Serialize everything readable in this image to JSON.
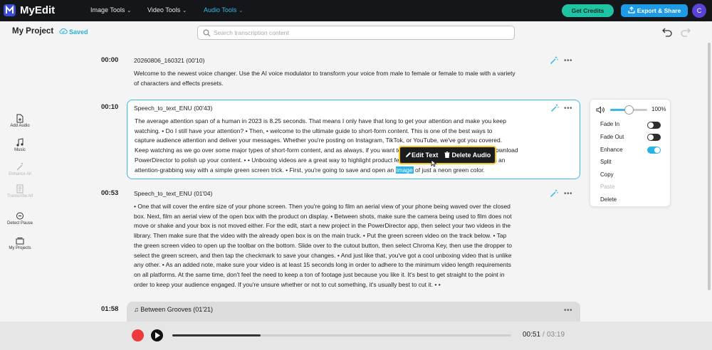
{
  "app": {
    "name": "MyEdit"
  },
  "nav": [
    {
      "label": "Image Tools",
      "active": false
    },
    {
      "label": "Video Tools",
      "active": false
    },
    {
      "label": "Audio Tools",
      "active": true
    }
  ],
  "header": {
    "get_credits": "Get Credits",
    "export_share": "Export & Share",
    "avatar_initial": "C"
  },
  "project": {
    "title": "My Project",
    "status": "Saved"
  },
  "search": {
    "placeholder": "Search transcription content",
    "value": ""
  },
  "sidebar": [
    {
      "label": "Add Audio",
      "icon": "add-audio-icon",
      "enabled": true
    },
    {
      "label": "Music",
      "icon": "music-icon",
      "enabled": true
    },
    {
      "label": "Enhance All",
      "icon": "enhance-icon",
      "enabled": false
    },
    {
      "label": "Transcribe All",
      "icon": "transcribe-icon",
      "enabled": false
    },
    {
      "label": "Detect Pause",
      "icon": "detect-pause-icon",
      "enabled": true
    },
    {
      "label": "My Projects",
      "icon": "folder-icon",
      "enabled": true
    }
  ],
  "transcript": [
    {
      "time": "00:00",
      "title": "20260806_160321  (00'10)",
      "lines": [
        "Welcome to the newest voice changer. Use the AI voice modulator to transform your voice from male to female or female to male with a variety",
        "of characters and effects presets."
      ]
    },
    {
      "time": "00:10",
      "title": "Speech_to_text_ENU  (00'43)",
      "lines": [
        "The average attention span of a human in 2023 is 8.25 seconds. That means I only have that long to get your attention and make you keep",
        "watching.  •  Do I still have your attention?  •  Then,  •  welcome to the ultimate guide to short-form content. This is one of the best ways to",
        "capture audience attention and deliver your messages. Whether you're posting on Instagram, TikTok, or YouTube, we've got you covered.",
        "Keep watching as we go over some major types of short-form content, and as always, if you want to follow along, click the button and download",
        "PowerDirector to polish up your content.  •  •  Unboxing videos are a great way to highlight product features, and you can execute them in an",
        "attention-grabbing way with a simple green screen trick.  •  First, you're going to save and open an"
      ],
      "highlight": "image",
      "tail": " of just a neon green color."
    },
    {
      "time": "00:53",
      "title": "Speech_to_text_ENU  (01'04)",
      "lines": [
        "•  One that will cover the entire size of your phone screen. Then you're going to film an aerial view of your phone being waved over the closed",
        "box. Next, film an aerial view of the open box with the product on display.  •  Between shots, make sure the camera being used to film does not",
        "move or shake and your box is not moved either. For the edit, start a new project in the PowerDirector app, then select your two videos in the",
        "library. Then make sure that the video with the already open box is on the main truck.  •  Put the green screen video on the track below.  •  Tap",
        "the green screen video to open up the toolbar on the bottom. Slide over to the cutout button, then select Chroma Key, then use the dropper to",
        "select the green screen, and then tap the checkmark to save your changes.  •  And just like that, you've got a cool unboxing video that is unlike",
        "any other.  •  As an added note, make sure your video is at least 15 seconds long in order to adhere to the minimum video length requirements",
        "on all platforms. At the same time, don't feel the need to keep a ton of footage just because you like it. It's best to get straight to the point in",
        "order to keep your audience engaged. If you're unsure whether or not to cut something, it's usually best to cut it.  •  •"
      ]
    },
    {
      "time": "01:58",
      "title": "Between Grooves  (01'21)",
      "type": "music"
    }
  ],
  "popup": {
    "edit_text": "Edit Text",
    "delete_audio": "Delete Audio"
  },
  "context_menu": {
    "volume": "100%",
    "volume_level": 0.5,
    "items": [
      {
        "label": "Fade In",
        "toggle": false
      },
      {
        "label": "Fade Out",
        "toggle": false
      },
      {
        "label": "Enhance",
        "toggle": true
      },
      {
        "label": "Split"
      },
      {
        "label": "Copy"
      },
      {
        "label": "Paste",
        "disabled": true
      },
      {
        "label": "Delete"
      }
    ]
  },
  "player": {
    "current": "00:51",
    "separator": "/",
    "total": "03:19",
    "progress": 0.26
  },
  "colors": {
    "accent": "#3ab8e6",
    "credits": "#1fc4a4",
    "export": "#1f9be6",
    "popup_border": "#f0c419",
    "record": "#ee3a3a"
  }
}
